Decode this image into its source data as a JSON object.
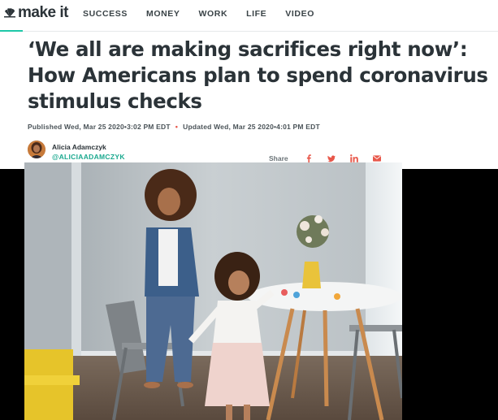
{
  "nav": {
    "logo_text": "make it",
    "items": [
      "SUCCESS",
      "MONEY",
      "WORK",
      "LIFE",
      "VIDEO"
    ]
  },
  "article": {
    "headline": "‘We all are making sacrifices right now’:\nHow Americans plan to spend coronavirus\nstimulus checks",
    "published": "Published Wed, Mar 25 2020•3:02 PM EDT",
    "updated": "Updated Wed, Mar 25 2020•4:01 PM EDT",
    "author_name": "Alicia Adamczyk",
    "author_handle": "@ALICIAADAMCZYK",
    "share_label": "Share",
    "share_icons": [
      "facebook-icon",
      "twitter-icon",
      "linkedin-icon",
      "email-icon"
    ]
  },
  "colors": {
    "accent": "#1ec8a8",
    "share_icon": "#e8574a",
    "headline": "#2b3338",
    "background_band": "#000000"
  }
}
